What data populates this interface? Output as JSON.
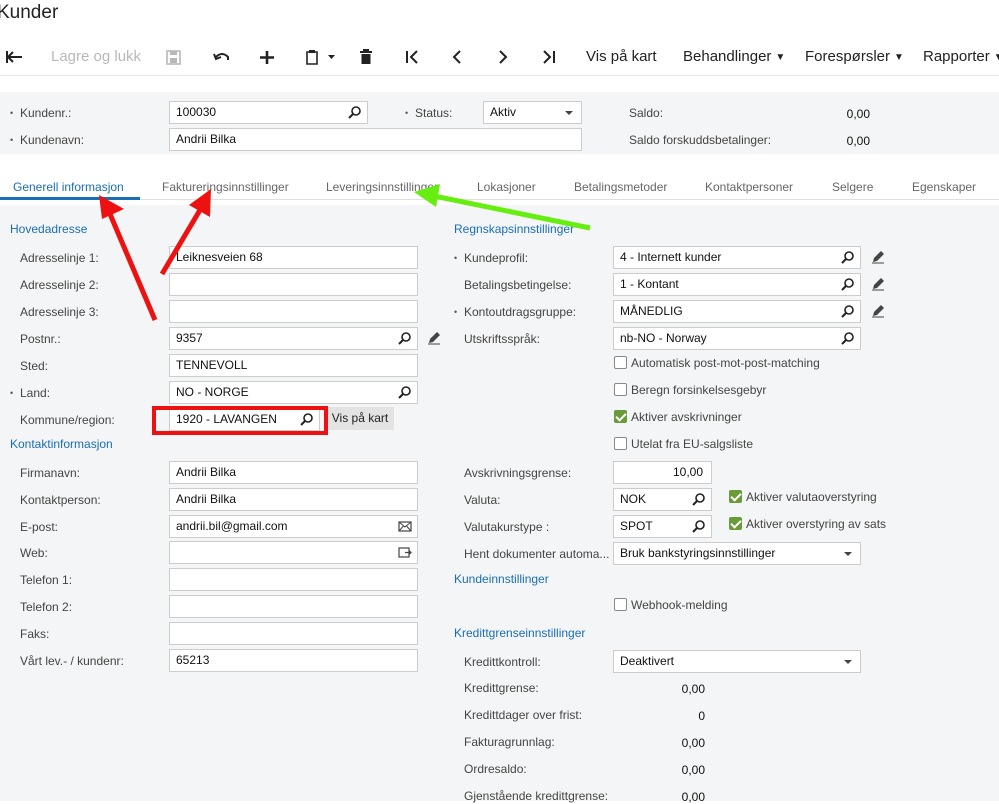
{
  "window": {
    "title": "Kunder"
  },
  "toolbar": {
    "back_icon": "back-arrow-icon",
    "save_close_label": "Lagre og lukk",
    "save_icon": "save-icon",
    "undo_icon": "undo-icon",
    "add_icon": "plus-icon",
    "copy_icon": "clipboard-icon",
    "delete_icon": "trash-icon",
    "first_icon": "first-record-icon",
    "prev_icon": "previous-record-icon",
    "next_icon": "next-record-icon",
    "last_icon": "last-record-icon",
    "map_label": "Vis på kart",
    "actions_label": "Behandlinger",
    "inquiries_label": "Forespørsler",
    "reports_label": "Rapporter"
  },
  "header": {
    "customer_id_label": "Kundenr.:",
    "customer_id_value": "100030",
    "customer_name_label": "Kundenavn:",
    "customer_name_value": "Andrii Bilka",
    "status_label": "Status:",
    "status_value": "Aktiv",
    "balance_label": "Saldo:",
    "balance_value": "0,00",
    "prepay_label": "Saldo forskuddsbetalinger:",
    "prepay_value": "0,00"
  },
  "tabs": [
    {
      "label": "Generell informasjon",
      "active": true
    },
    {
      "label": "Faktureringsinnstillinger",
      "active": false
    },
    {
      "label": "Leveringsinnstillinger",
      "active": false
    },
    {
      "label": "Lokasjoner",
      "active": false
    },
    {
      "label": "Betalingsmetoder",
      "active": false
    },
    {
      "label": "Kontaktpersoner",
      "active": false
    },
    {
      "label": "Selgere",
      "active": false
    },
    {
      "label": "Egenskaper",
      "active": false
    }
  ],
  "address": {
    "section": "Hovedadresse",
    "line1_label": "Adresselinje 1:",
    "line1_value": "Leiknesveien 68",
    "line2_label": "Adresselinje 2:",
    "line2_value": "",
    "line3_label": "Adresselinje 3:",
    "line3_value": "",
    "postal_label": "Postnr.:",
    "postal_value": "9357",
    "city_label": "Sted:",
    "city_value": "TENNEVOLL",
    "country_label": "Land:",
    "country_value": "NO - NORGE",
    "region_label": "Kommune/region:",
    "region_value": "1920 - LAVANGEN",
    "map_button": "Vis på kart"
  },
  "contact": {
    "section": "Kontaktinformasjon",
    "company_label": "Firmanavn:",
    "company_value": "Andrii Bilka",
    "person_label": "Kontaktperson:",
    "person_value": "Andrii Bilka",
    "email_label": "E-post:",
    "email_value": "andrii.bil@gmail.com",
    "web_label": "Web:",
    "web_value": "",
    "phone1_label": "Telefon 1:",
    "phone1_value": "",
    "phone2_label": "Telefon 2:",
    "phone2_value": "",
    "fax_label": "Faks:",
    "fax_value": "",
    "vendor_label": "Vårt lev.- / kundenr:",
    "vendor_value": "65213"
  },
  "financial": {
    "section": "Regnskapsinnstillinger",
    "class_label": "Kundeprofil:",
    "class_value": "4 - Internett kunder",
    "terms_label": "Betalingsbetingelse:",
    "terms_value": "1 - Kontant",
    "stmt_label": "Kontoutdragsgruppe:",
    "stmt_value": "MÅNEDLIG",
    "lang_label": "Utskriftsspråk:",
    "lang_value": "nb-NO - Norway",
    "auto_apply_label": "Automatisk post-mot-post-matching",
    "auto_apply_checked": false,
    "overdue_label": "Beregn forsinkelsesgebyr",
    "overdue_checked": false,
    "writeoff_label": "Aktiver avskrivninger",
    "writeoff_checked": true,
    "eu_label": "Utelat fra EU-salgsliste",
    "eu_checked": false,
    "writeoff_limit_label": "Avskrivningsgrense:",
    "writeoff_limit_value": "10,00",
    "currency_label": "Valuta:",
    "currency_value": "NOK",
    "currency_override_label": "Aktiver valutaoverstyring",
    "currency_override_checked": true,
    "rate_type_label": "Valutakurstype :",
    "rate_type_value": "SPOT",
    "rate_override_label": "Aktiver overstyring av sats",
    "rate_override_checked": true,
    "fetch_docs_label": "Hent dokumenter automa...",
    "fetch_docs_value": "Bruk bankstyringsinnstillinger"
  },
  "customer_settings": {
    "section": "Kundeinnstillinger",
    "webhook_label": "Webhook-melding",
    "webhook_checked": false
  },
  "credit": {
    "section": "Kredittgrenseinnstillinger",
    "verify_label": "Kredittkontroll:",
    "verify_value": "Deaktivert",
    "limit_label": "Kredittgrense:",
    "limit_value": "0,00",
    "days_label": "Kredittdager over frist:",
    "days_value": "0",
    "basis_label": "Fakturagrunnlag:",
    "basis_value": "0,00",
    "order_label": "Ordresaldo:",
    "order_value": "0,00",
    "remaining_label": "Gjenstående kredittgrense:",
    "remaining_value": "0,00"
  },
  "annotation_colors": {
    "red": "#ee1111",
    "green": "#66ee11"
  }
}
